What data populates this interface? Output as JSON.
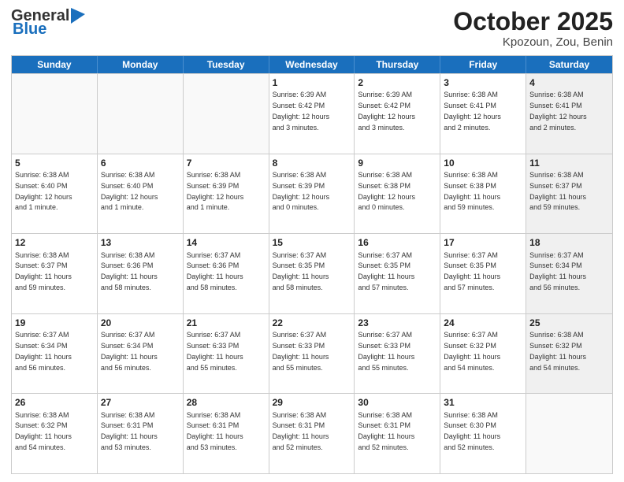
{
  "header": {
    "logo_general": "General",
    "logo_blue": "Blue",
    "month": "October 2025",
    "location": "Kpozoun, Zou, Benin"
  },
  "days_of_week": [
    "Sunday",
    "Monday",
    "Tuesday",
    "Wednesday",
    "Thursday",
    "Friday",
    "Saturday"
  ],
  "weeks": [
    [
      {
        "day": "",
        "info": ""
      },
      {
        "day": "",
        "info": ""
      },
      {
        "day": "",
        "info": ""
      },
      {
        "day": "1",
        "info": "Sunrise: 6:39 AM\nSunset: 6:42 PM\nDaylight: 12 hours\nand 3 minutes."
      },
      {
        "day": "2",
        "info": "Sunrise: 6:39 AM\nSunset: 6:42 PM\nDaylight: 12 hours\nand 3 minutes."
      },
      {
        "day": "3",
        "info": "Sunrise: 6:38 AM\nSunset: 6:41 PM\nDaylight: 12 hours\nand 2 minutes."
      },
      {
        "day": "4",
        "info": "Sunrise: 6:38 AM\nSunset: 6:41 PM\nDaylight: 12 hours\nand 2 minutes."
      }
    ],
    [
      {
        "day": "5",
        "info": "Sunrise: 6:38 AM\nSunset: 6:40 PM\nDaylight: 12 hours\nand 1 minute."
      },
      {
        "day": "6",
        "info": "Sunrise: 6:38 AM\nSunset: 6:40 PM\nDaylight: 12 hours\nand 1 minute."
      },
      {
        "day": "7",
        "info": "Sunrise: 6:38 AM\nSunset: 6:39 PM\nDaylight: 12 hours\nand 1 minute."
      },
      {
        "day": "8",
        "info": "Sunrise: 6:38 AM\nSunset: 6:39 PM\nDaylight: 12 hours\nand 0 minutes."
      },
      {
        "day": "9",
        "info": "Sunrise: 6:38 AM\nSunset: 6:38 PM\nDaylight: 12 hours\nand 0 minutes."
      },
      {
        "day": "10",
        "info": "Sunrise: 6:38 AM\nSunset: 6:38 PM\nDaylight: 11 hours\nand 59 minutes."
      },
      {
        "day": "11",
        "info": "Sunrise: 6:38 AM\nSunset: 6:37 PM\nDaylight: 11 hours\nand 59 minutes."
      }
    ],
    [
      {
        "day": "12",
        "info": "Sunrise: 6:38 AM\nSunset: 6:37 PM\nDaylight: 11 hours\nand 59 minutes."
      },
      {
        "day": "13",
        "info": "Sunrise: 6:38 AM\nSunset: 6:36 PM\nDaylight: 11 hours\nand 58 minutes."
      },
      {
        "day": "14",
        "info": "Sunrise: 6:37 AM\nSunset: 6:36 PM\nDaylight: 11 hours\nand 58 minutes."
      },
      {
        "day": "15",
        "info": "Sunrise: 6:37 AM\nSunset: 6:35 PM\nDaylight: 11 hours\nand 58 minutes."
      },
      {
        "day": "16",
        "info": "Sunrise: 6:37 AM\nSunset: 6:35 PM\nDaylight: 11 hours\nand 57 minutes."
      },
      {
        "day": "17",
        "info": "Sunrise: 6:37 AM\nSunset: 6:35 PM\nDaylight: 11 hours\nand 57 minutes."
      },
      {
        "day": "18",
        "info": "Sunrise: 6:37 AM\nSunset: 6:34 PM\nDaylight: 11 hours\nand 56 minutes."
      }
    ],
    [
      {
        "day": "19",
        "info": "Sunrise: 6:37 AM\nSunset: 6:34 PM\nDaylight: 11 hours\nand 56 minutes."
      },
      {
        "day": "20",
        "info": "Sunrise: 6:37 AM\nSunset: 6:34 PM\nDaylight: 11 hours\nand 56 minutes."
      },
      {
        "day": "21",
        "info": "Sunrise: 6:37 AM\nSunset: 6:33 PM\nDaylight: 11 hours\nand 55 minutes."
      },
      {
        "day": "22",
        "info": "Sunrise: 6:37 AM\nSunset: 6:33 PM\nDaylight: 11 hours\nand 55 minutes."
      },
      {
        "day": "23",
        "info": "Sunrise: 6:37 AM\nSunset: 6:33 PM\nDaylight: 11 hours\nand 55 minutes."
      },
      {
        "day": "24",
        "info": "Sunrise: 6:37 AM\nSunset: 6:32 PM\nDaylight: 11 hours\nand 54 minutes."
      },
      {
        "day": "25",
        "info": "Sunrise: 6:38 AM\nSunset: 6:32 PM\nDaylight: 11 hours\nand 54 minutes."
      }
    ],
    [
      {
        "day": "26",
        "info": "Sunrise: 6:38 AM\nSunset: 6:32 PM\nDaylight: 11 hours\nand 54 minutes."
      },
      {
        "day": "27",
        "info": "Sunrise: 6:38 AM\nSunset: 6:31 PM\nDaylight: 11 hours\nand 53 minutes."
      },
      {
        "day": "28",
        "info": "Sunrise: 6:38 AM\nSunset: 6:31 PM\nDaylight: 11 hours\nand 53 minutes."
      },
      {
        "day": "29",
        "info": "Sunrise: 6:38 AM\nSunset: 6:31 PM\nDaylight: 11 hours\nand 52 minutes."
      },
      {
        "day": "30",
        "info": "Sunrise: 6:38 AM\nSunset: 6:31 PM\nDaylight: 11 hours\nand 52 minutes."
      },
      {
        "day": "31",
        "info": "Sunrise: 6:38 AM\nSunset: 6:30 PM\nDaylight: 11 hours\nand 52 minutes."
      },
      {
        "day": "",
        "info": ""
      }
    ]
  ]
}
